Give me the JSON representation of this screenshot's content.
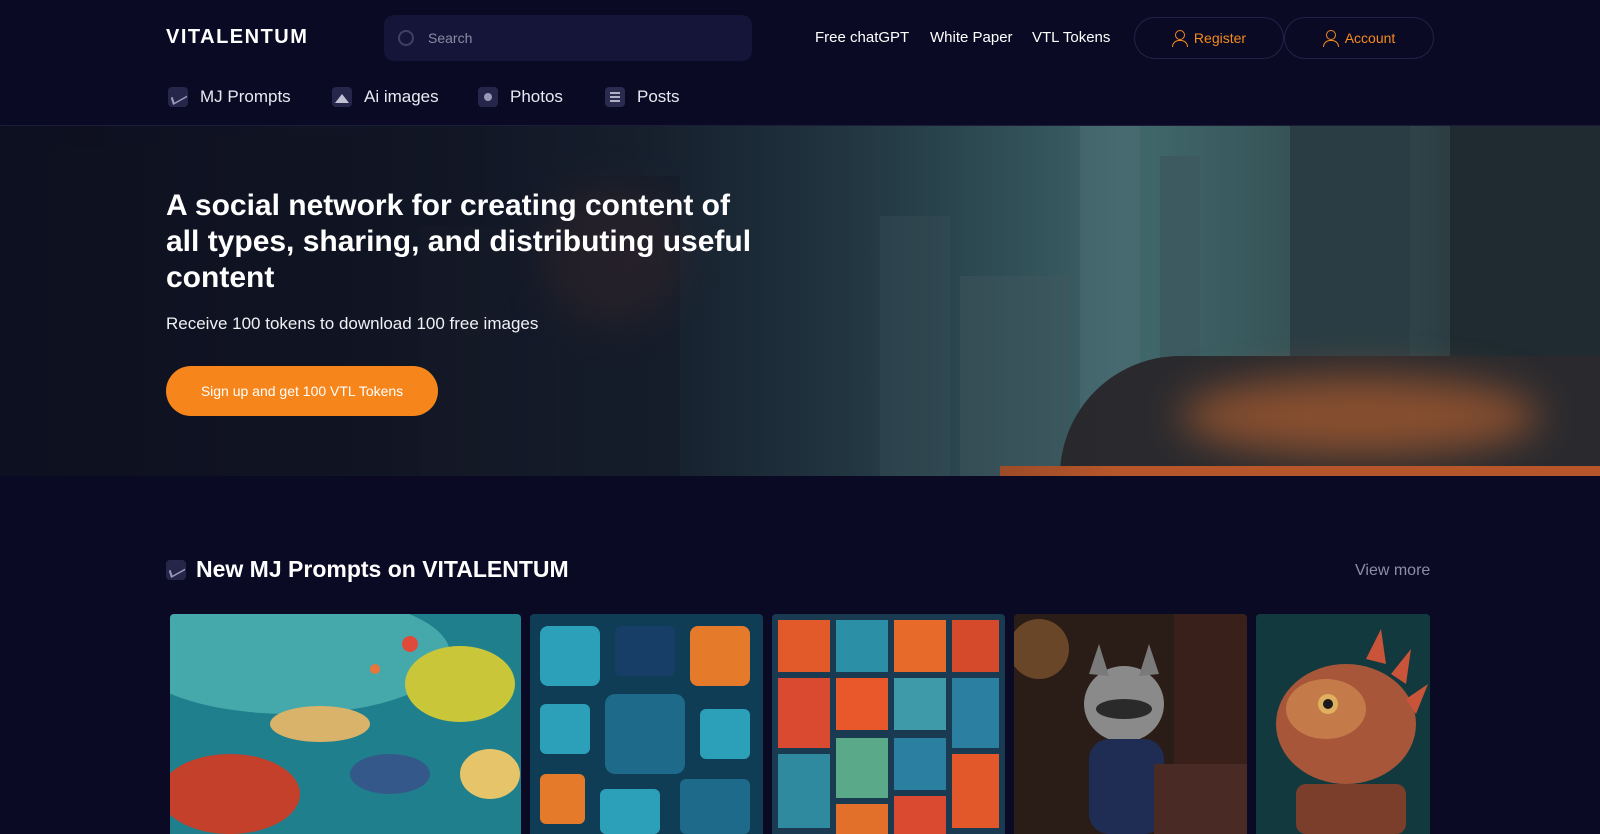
{
  "header": {
    "logo": "VITALENTUM",
    "search_placeholder": "Search",
    "links": [
      "Free chatGPT",
      "White Paper",
      "VTL Tokens"
    ],
    "register_label": "Register",
    "account_label": "Account"
  },
  "nav": {
    "items": [
      {
        "label": "MJ Prompts",
        "icon": "chart-icon"
      },
      {
        "label": "Ai images",
        "icon": "image-icon"
      },
      {
        "label": "Photos",
        "icon": "photo-icon"
      },
      {
        "label": "Posts",
        "icon": "post-icon"
      }
    ]
  },
  "hero": {
    "title": "A social network for creating content of all types, sharing, and distributing useful content",
    "subtitle": "Receive 100 tokens to download 100 free images",
    "cta_label": "Sign up and get 100 VTL Tokens"
  },
  "section": {
    "title": "New MJ Prompts on VITALENTUM",
    "view_more": "View more"
  },
  "colors": {
    "background": "#0a0a24",
    "accent": "#f6861b",
    "search_bg": "#15153a"
  }
}
